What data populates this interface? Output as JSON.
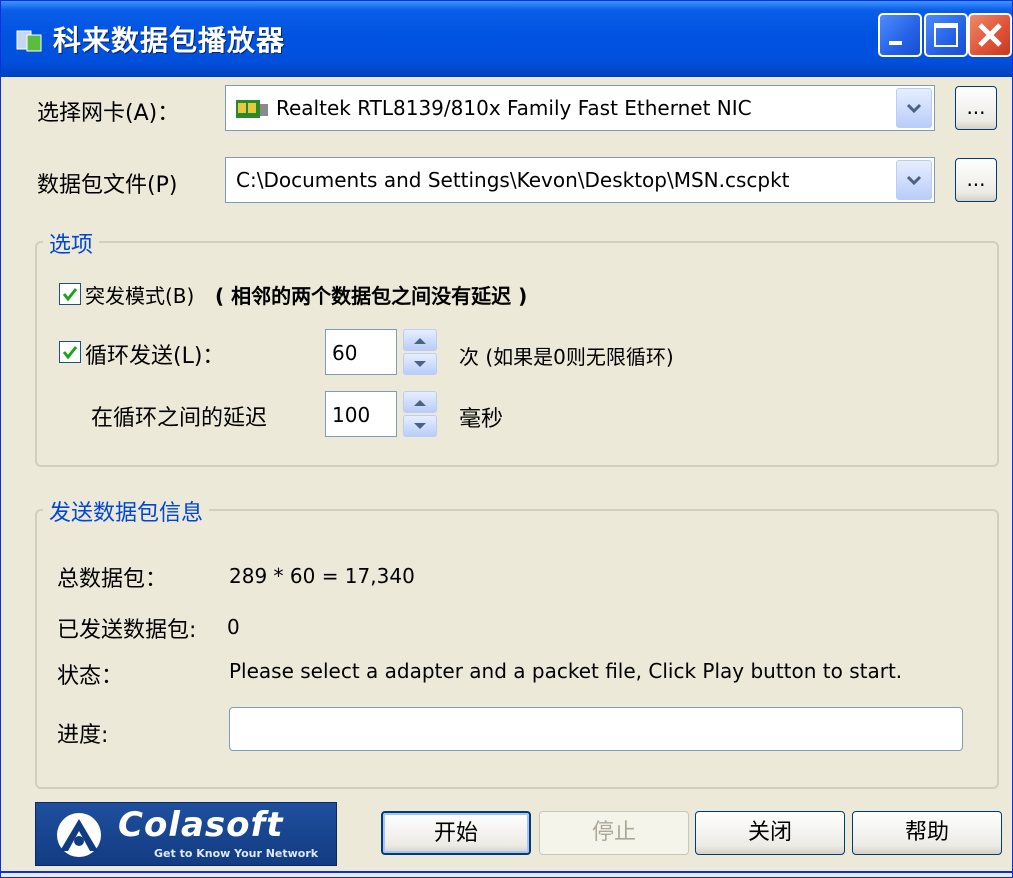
{
  "window": {
    "title": "科来数据包播放器"
  },
  "adapter": {
    "label": "选择网卡(A)：",
    "value": "Realtek RTL8139/810x Family Fast Ethernet NIC",
    "browse_label": "..."
  },
  "packet_file": {
    "label": "数据包文件(P)",
    "value": "C:\\Documents and Settings\\Kevon\\Desktop\\MSN.cscpkt",
    "browse_label": "..."
  },
  "options": {
    "title": "选项",
    "burst": {
      "label": "突发模式(B)",
      "note": "( 相邻的两个数据包之间没有延迟 )",
      "checked": true
    },
    "loop": {
      "label": "循环发送(L)：",
      "value": "60",
      "unit": "次 (如果是0则无限循环)",
      "checked": true
    },
    "delay": {
      "label": "在循环之间的延迟",
      "value": "100",
      "unit": "毫秒"
    }
  },
  "info": {
    "title": "发送数据包信息",
    "total_label": "总数据包：",
    "total_value": "289 * 60 = 17,340",
    "sent_label": "已发送数据包:",
    "sent_value": "0",
    "status_label": "状态：",
    "status_value": "Please select a adapter and a packet file, Click Play button to start.",
    "progress_label": "进度:",
    "progress_fraction": 0
  },
  "logo": {
    "name": "Colasoft",
    "tagline": "Get to Know Your Network"
  },
  "buttons": {
    "start": "开始",
    "stop": "停止",
    "close": "关闭",
    "help": "帮助"
  },
  "colors": {
    "titlebar": "#0053e1",
    "group_title": "#0046d5",
    "face": "#ece9d8"
  },
  "icons": {
    "title": "app-icon",
    "nic": "network-card-icon",
    "check": "checkmark-icon"
  }
}
